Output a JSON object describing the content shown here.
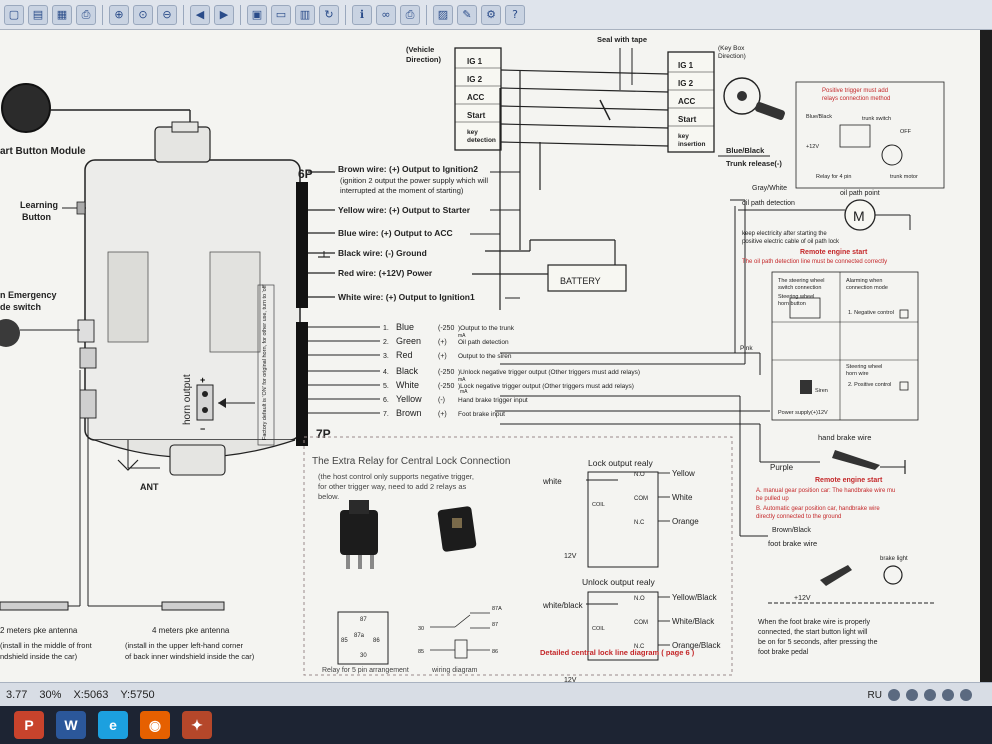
{
  "toolbar": {
    "icons": [
      "new-icon",
      "open-icon",
      "save-icon",
      "print-icon",
      "zoom-in-icon",
      "zoom-region-icon",
      "zoom-out-icon",
      "back-icon",
      "forward-icon",
      "fit-page-icon",
      "fit-width-icon",
      "slideshow-icon",
      "rotate-icon",
      "properties-icon",
      "binoculars-icon",
      "print-icon",
      "scan-icon",
      "edit-icon",
      "settings-icon",
      "help-icon"
    ]
  },
  "diagram": {
    "button_module": "art Button Module",
    "learning_button": "Learning\nButton",
    "emergency_switch": "n Emergency\nde switch",
    "ant": "ANT",
    "horn_output": "horn output",
    "connector_6p": "6P",
    "connector_7p": "7P",
    "vertical_note": "Factory default is 'ON' for original horn, for other use, turn to 'off'",
    "vehicle_direction": "(Vehicle\nDirection)",
    "seal_with_tape": "Seal with tape",
    "key_box_direction": "(Key Box\nDirection)",
    "ig_left": [
      "IG 1",
      "IG 2",
      "ACC",
      "Start",
      "key\ndetection"
    ],
    "ig_right": [
      "IG 1",
      "IG 2",
      "ACC",
      "Start",
      "key\ninsertion"
    ],
    "wires_6p": [
      {
        "text": "Brown wire: (+) Output to Ignition2"
      },
      {
        "text": "(ignition 2 output the power supply which will\ninterrupted at the moment of starting)"
      },
      {
        "text": "Yellow wire: (+) Output to Starter"
      },
      {
        "text": "Blue wire: (+) Output to ACC"
      },
      {
        "text": "Black wire: (-) Ground"
      },
      {
        "text": "Red wire: (+12V) Power"
      },
      {
        "text": "White wire: (+) Output to Ignition1"
      }
    ],
    "battery": "BATTERY",
    "wires_7p": [
      {
        "num": "1.",
        "color": "Blue",
        "spec": "(-250",
        "desc": ")Output to the trunk"
      },
      {
        "num": "2.",
        "color": "Green",
        "spec": "(+)",
        "desc": "Oil path detection"
      },
      {
        "num": "3.",
        "color": "Red",
        "spec": "(+)",
        "desc": "Output to the siren"
      },
      {
        "num": "4.",
        "color": "Black",
        "spec": "(-250",
        "desc": ")Unlock negative trigger output  (Other triggers must add relays)"
      },
      {
        "num": "5.",
        "color": "White",
        "spec": "(-250",
        "desc": ")Lock negative trigger output  (Other triggers must add relays)"
      },
      {
        "num": "6.",
        "color": "Yellow",
        "spec": "(-)",
        "desc": "Hand brake trigger input"
      },
      {
        "num": "7.",
        "color": "Brown",
        "spec": "(+)",
        "desc": "Foot brake input"
      }
    ],
    "ma": "mA",
    "extra_relay_title": "The Extra Relay for Central  Lock Connection",
    "extra_relay_note": "(the host control only supports negative trigger,\nfor other trigger way, need to add 2 relays as\nbelow.",
    "relay_caption": "Relay for 5 pin arrangement",
    "wiring_caption": "wiring diagram",
    "lock_relay_title": "Lock output realy",
    "unlock_relay_title": "Unlock output realy",
    "lock_white": "white",
    "unlock_white": "white/black",
    "relay_labels": [
      "N.O",
      "COM",
      "N.C",
      "COIL",
      "12V"
    ],
    "lock_out": [
      "Yellow",
      "White",
      "Orange"
    ],
    "unlock_out": [
      "Yellow/Black",
      "White/Black",
      "Orange/Black"
    ],
    "central_lock_caption": "Detailed central lock line diagram ( page 6 )",
    "relay_pins": [
      "87",
      "87a",
      "85",
      "86",
      "30"
    ],
    "wiring_pins": [
      "87A",
      "87",
      "30",
      "85",
      "86"
    ],
    "antenna_2m": "2 meters pke antenna",
    "antenna_2m_note": "(install in the  middle of front\nndshield inside the car)",
    "antenna_4m": "4 meters pke  antenna",
    "antenna_4m_note": "(install in the  upper left-hand corner\nof back inner windshield inside the car)",
    "trunk_release": "Blue/Black\nTrunk release(-)",
    "positive_trigger_title": "Positive trigger must add\nrelays connection method",
    "positive_trigger_labels": [
      "Blue/Black",
      "trunk switch",
      "+12V",
      "OFF",
      "Relay for 4 pin",
      "trunk motor"
    ],
    "gray_white": "Gray/White",
    "oil_path_detection": "oil path detection",
    "oil_path_point": "oil path point",
    "motor_letter": "M",
    "oil_note": "keep electricity after starting the\npositive electric cable of oil path lock",
    "remote_engine_start": "Remote  engine start",
    "oil_red_note": "The oil path detection line must be connected correctly",
    "steering_title": "The steering wheel\nswitch connection",
    "alarming_title": "Alarming when\nconnection mode",
    "steering_labels": [
      "Steering wheel\nhorn button",
      "1. Negative control",
      "Steering wheel\nhorn wire",
      "2. Positive control"
    ],
    "pink": "Pink",
    "power_supply": "Power supply(+)12V",
    "siren": "Siren",
    "hand_brake_wire": "hand brake wire",
    "purple": "Purple",
    "remote_start_2": "Remote  engine start",
    "hand_brake_red": "A. manual gear position car: The handbrake wire mu\nbe pulled up\nB. Automatic gear position car, handbrake wire\ndirectly connected to the ground",
    "brown_black": "Brown/Black",
    "foot_brake_wire": "foot brake wire",
    "brake_light": "brake light",
    "plus12v": "+12V",
    "foot_brake_note": "When the foot brake wire is properly\nconnected, the start button light will\nbe on for 5 seconds, after pressing the\nfoot brake pedal"
  },
  "status": {
    "page": "3.77",
    "zoom": "30%",
    "x": "X:5063",
    "y": "Y:5750",
    "lang": "RU"
  },
  "taskbar": {
    "apps": [
      {
        "name": "powerpoint",
        "label": "P",
        "color": "#c8432c"
      },
      {
        "name": "word",
        "label": "W",
        "color": "#2b579a"
      },
      {
        "name": "ie",
        "label": "e",
        "color": "#1ca0df"
      },
      {
        "name": "firefox",
        "label": "◉",
        "color": "#e66000"
      },
      {
        "name": "viewer",
        "label": "✦",
        "color": "#b5472a"
      }
    ]
  },
  "colors": {
    "canvas_bg": "#f4f4f1",
    "red_text": "#c4282a",
    "dashed_border": "#9a8a8a"
  }
}
